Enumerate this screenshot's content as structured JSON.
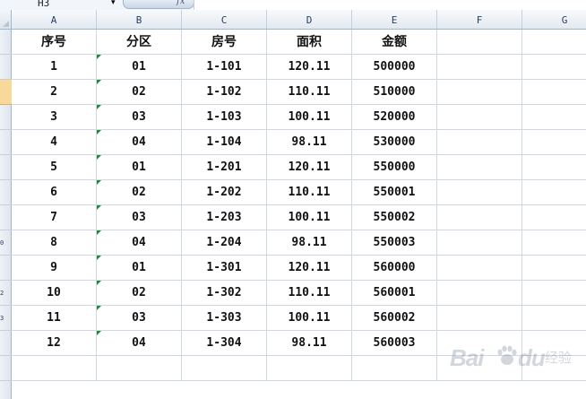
{
  "formula_bar": {
    "name_box": "H3",
    "fx_label": "fx",
    "value": ""
  },
  "columns": [
    "A",
    "B",
    "C",
    "D",
    "E",
    "F",
    "G"
  ],
  "row_numbers": [
    "",
    "",
    "",
    "",
    "",
    "",
    "",
    "",
    "0",
    "",
    "2",
    "3",
    "",
    ""
  ],
  "table": {
    "headers": [
      "序号",
      "分区",
      "房号",
      "面积",
      "金额"
    ],
    "rows": [
      [
        "1",
        "01",
        "1-101",
        "120.11",
        "500000"
      ],
      [
        "2",
        "02",
        "1-102",
        "110.11",
        "510000"
      ],
      [
        "3",
        "03",
        "1-103",
        "100.11",
        "520000"
      ],
      [
        "4",
        "04",
        "1-104",
        "98.11",
        "530000"
      ],
      [
        "5",
        "01",
        "1-201",
        "120.11",
        "550000"
      ],
      [
        "6",
        "02",
        "1-202",
        "110.11",
        "550001"
      ],
      [
        "7",
        "03",
        "1-203",
        "100.11",
        "550002"
      ],
      [
        "8",
        "04",
        "1-204",
        "98.11",
        "550003"
      ],
      [
        "9",
        "01",
        "1-301",
        "120.11",
        "560000"
      ],
      [
        "10",
        "02",
        "1-302",
        "110.11",
        "560001"
      ],
      [
        "11",
        "03",
        "1-303",
        "100.11",
        "560002"
      ],
      [
        "12",
        "04",
        "1-304",
        "98.11",
        "560003"
      ]
    ]
  },
  "watermark": {
    "brand": "Bai",
    "brand2": "du",
    "suffix": "经验"
  },
  "colors": {
    "active_row": "#f9d99a",
    "text_flag": "#1f8a3a",
    "header_bg": "#e3e9f1"
  }
}
